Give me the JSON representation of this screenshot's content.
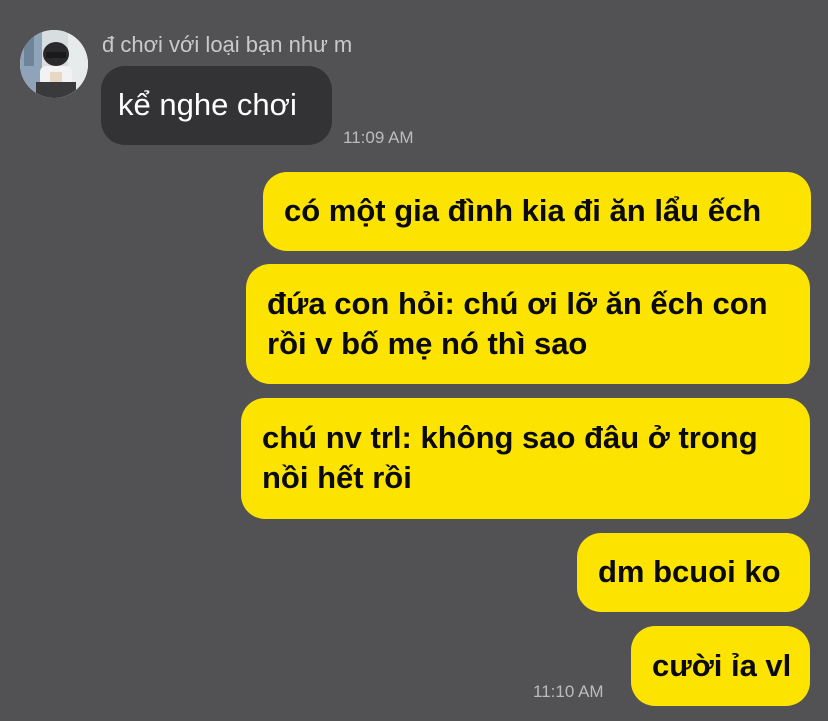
{
  "chat": {
    "sender_name": "đ chơi với loại bạn như m",
    "avatar_icon": "profile-photo",
    "incoming": [
      {
        "text": "kể nghe chơi",
        "time": "11:09 AM"
      }
    ],
    "outgoing": [
      {
        "lines": [
          "có một gia đình kia đi ăn lẩu ếch"
        ]
      },
      {
        "lines": [
          "đứa con hỏi: chú ơi lỡ ăn ếch con",
          "rồi v bố mẹ nó thì sao"
        ]
      },
      {
        "lines": [
          "chú nv trl: không sao đâu ở trong",
          "nồi hết rồi"
        ]
      },
      {
        "lines": [
          "dm bcuoi ko"
        ]
      },
      {
        "lines": [
          "cười ỉa vl"
        ]
      }
    ],
    "outgoing_time": "11:10 AM"
  },
  "colors": {
    "background": "#525154",
    "incoming_bubble": "#333235",
    "outgoing_bubble": "#fde400",
    "timestamp": "#bcbcbf"
  }
}
